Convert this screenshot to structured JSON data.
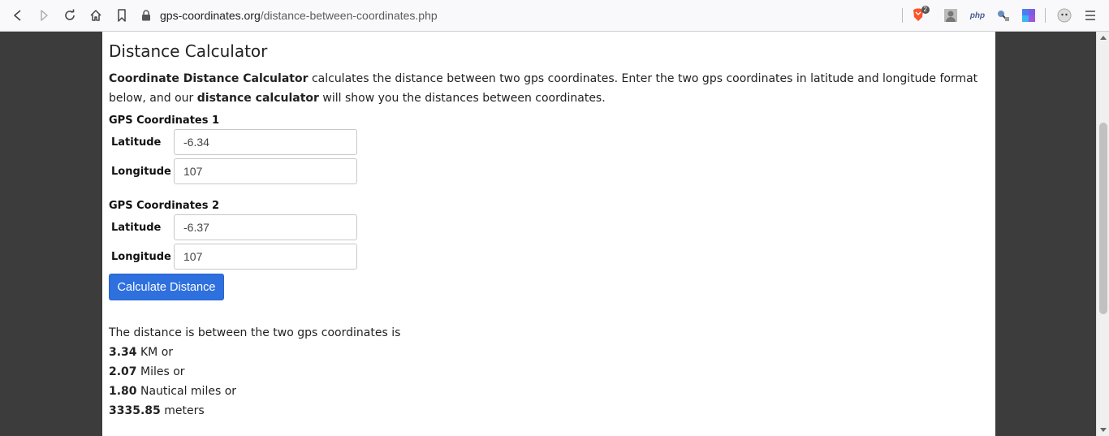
{
  "browser": {
    "url_host": "gps-coordinates.org",
    "url_path": "/distance-between-coordinates.php",
    "brave_badge": "2",
    "ext_php_label": "php"
  },
  "page": {
    "title": "Distance Calculator",
    "intro": {
      "bold1": "Coordinate Distance Calculator",
      "text1": " calculates the distance between two gps coordinates. Enter the two gps coordinates in latitude and longitude format below, and our ",
      "bold2": "distance calculator",
      "text2": " will show you the distances between coordinates."
    },
    "coords1": {
      "title": "GPS Coordinates 1",
      "lat_label": "Latitude",
      "lat_value": "-6.34",
      "lon_label": "Longitude",
      "lon_value": "107"
    },
    "coords2": {
      "title": "GPS Coordinates 2",
      "lat_label": "Latitude",
      "lat_value": "-6.37",
      "lon_label": "Longitude",
      "lon_value": "107"
    },
    "button_label": "Calculate Distance",
    "result": {
      "intro": "The distance is between the two gps coordinates is",
      "km_value": "3.34",
      "km_text": " KM or",
      "miles_value": "2.07",
      "miles_text": " Miles or",
      "nautical_value": "1.80",
      "nautical_text": " Nautical miles or",
      "meters_value": "3335.85",
      "meters_text": " meters"
    }
  },
  "colors": {
    "button": "#2e70de",
    "page_bg": "#3c3c3c",
    "brave": "#fb542b"
  }
}
